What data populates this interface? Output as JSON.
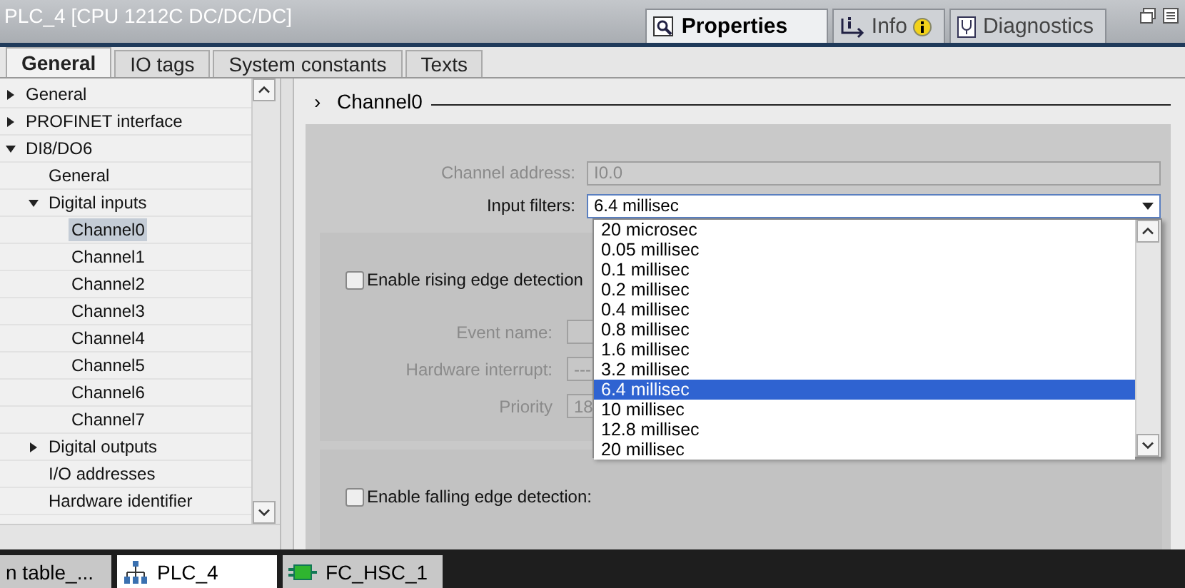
{
  "window": {
    "title": "PLC_4 [CPU 1212C DC/DC/DC]"
  },
  "inspector_tabs": [
    {
      "label": "Properties",
      "selected": true
    },
    {
      "label": "Info",
      "selected": false
    },
    {
      "label": "Diagnostics",
      "selected": false
    }
  ],
  "tabs": [
    {
      "label": "General",
      "selected": true
    },
    {
      "label": "IO tags",
      "selected": false
    },
    {
      "label": "System constants",
      "selected": false
    },
    {
      "label": "Texts",
      "selected": false
    }
  ],
  "tree": [
    {
      "label": "General",
      "expanded": false,
      "selected": false
    },
    {
      "label": "PROFINET interface",
      "expanded": false,
      "selected": false
    },
    {
      "label": "DI8/DO6",
      "expanded": true,
      "selected": false,
      "children": [
        {
          "label": "General",
          "selected": false
        },
        {
          "label": "Digital inputs",
          "expanded": true,
          "selected": false,
          "children": [
            {
              "label": "Channel0",
              "selected": true
            },
            {
              "label": "Channel1",
              "selected": false
            },
            {
              "label": "Channel2",
              "selected": false
            },
            {
              "label": "Channel3",
              "selected": false
            },
            {
              "label": "Channel4",
              "selected": false
            },
            {
              "label": "Channel5",
              "selected": false
            },
            {
              "label": "Channel6",
              "selected": false
            },
            {
              "label": "Channel7",
              "selected": false
            }
          ]
        },
        {
          "label": "Digital outputs",
          "expanded": false,
          "selected": false
        },
        {
          "label": "I/O addresses",
          "selected": false
        },
        {
          "label": "Hardware identifier",
          "selected": false
        }
      ]
    }
  ],
  "section": {
    "arrow": "›",
    "title": "Channel0"
  },
  "channel_address": {
    "label": "Channel address:",
    "value": "I0.0",
    "disabled": true
  },
  "input_filters": {
    "label": "Input filters:",
    "value": "6.4 millisec",
    "expanded": true,
    "options": [
      {
        "label": "20 microsec",
        "selected": false
      },
      {
        "label": "0.05 millisec",
        "selected": false
      },
      {
        "label": "0.1 millisec",
        "selected": false
      },
      {
        "label": "0.2 millisec",
        "selected": false
      },
      {
        "label": "0.4 millisec",
        "selected": false
      },
      {
        "label": "0.8 millisec",
        "selected": false
      },
      {
        "label": "1.6 millisec",
        "selected": false
      },
      {
        "label": "3.2 millisec",
        "selected": false
      },
      {
        "label": "6.4 millisec",
        "selected": true
      },
      {
        "label": "10 millisec",
        "selected": false
      },
      {
        "label": "12.8 millisec",
        "selected": false
      },
      {
        "label": "20 millisec",
        "selected": false
      }
    ]
  },
  "rising_edge": {
    "label": "Enable rising edge detection",
    "checked": false,
    "fields": [
      {
        "label": "Event name:",
        "disabled": true
      },
      {
        "label": "Hardware interrupt:",
        "value": "---",
        "disabled": true
      },
      {
        "label": "Priority",
        "value": "18",
        "disabled": true
      }
    ]
  },
  "falling_edge": {
    "label": "Enable falling edge detection:",
    "checked": false
  },
  "taskbar": [
    {
      "label": "n table_...",
      "selected": false
    },
    {
      "label": "PLC_4",
      "selected": true
    },
    {
      "label": "FC_HSC_1",
      "selected": false
    }
  ]
}
